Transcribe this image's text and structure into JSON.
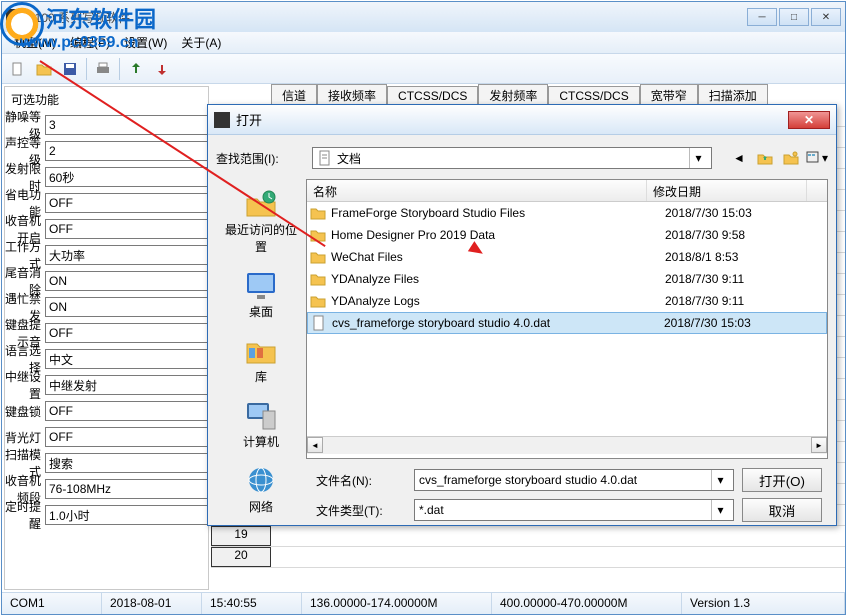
{
  "window": {
    "title": "9100 系列写频软件"
  },
  "menu": {
    "m1": "机型(M)",
    "m2": "编程(P)",
    "m3": "设置(W)",
    "m4": "关于(A)"
  },
  "sidebar": {
    "title": "可选功能",
    "rows": [
      {
        "label": "静噪等级",
        "value": "3"
      },
      {
        "label": "声控等级",
        "value": "2"
      },
      {
        "label": "发射限时",
        "value": "60秒"
      },
      {
        "label": "省电功能",
        "value": "OFF"
      },
      {
        "label": "收音机开启",
        "value": "OFF"
      },
      {
        "label": "工作方式",
        "value": "大功率"
      },
      {
        "label": "尾音消除",
        "value": "ON"
      },
      {
        "label": "遇忙禁发",
        "value": "ON"
      },
      {
        "label": "键盘提示音",
        "value": "OFF"
      },
      {
        "label": "语言选择",
        "value": "中文"
      },
      {
        "label": "中继设置",
        "value": "中继发射"
      },
      {
        "label": "键盘锁",
        "value": "OFF"
      },
      {
        "label": "背光灯",
        "value": "OFF"
      },
      {
        "label": "扫描模式",
        "value": "搜索"
      },
      {
        "label": "收音机频段",
        "value": "76-108MHz"
      },
      {
        "label": "定时提醒",
        "value": "1.0小时"
      }
    ]
  },
  "tabs": {
    "t1": "信道",
    "t2": "接收频率",
    "t3": "CTCSS/DCS",
    "t4": "发射频率",
    "t5": "CTCSS/DCS",
    "t6": "宽带窄",
    "t7": "扫描添加"
  },
  "grid_rows": [
    "19",
    "20"
  ],
  "status": {
    "port": "COM1",
    "date": "2018-08-01",
    "time": "15:40:55",
    "freq1": "136.00000-174.00000M",
    "freq2": "400.00000-470.00000M",
    "version": "Version 1.3"
  },
  "dialog": {
    "title": "打开",
    "lookin_label": "查找范围(I):",
    "lookin_value": "文档",
    "places": {
      "recent": "最近访问的位置",
      "desktop": "桌面",
      "library": "库",
      "computer": "计算机",
      "network": "网络"
    },
    "header_name": "名称",
    "header_date": "修改日期",
    "files": [
      {
        "name": "FrameForge Storyboard Studio Files",
        "date": "2018/7/30 15:03",
        "type": "folder"
      },
      {
        "name": "Home Designer Pro 2019 Data",
        "date": "2018/7/30 9:58",
        "type": "folder"
      },
      {
        "name": "WeChat Files",
        "date": "2018/8/1 8:53",
        "type": "folder"
      },
      {
        "name": "YDAnalyze Files",
        "date": "2018/7/30 9:11",
        "type": "folder"
      },
      {
        "name": "YDAnalyze Logs",
        "date": "2018/7/30 9:11",
        "type": "folder"
      },
      {
        "name": "cvs_frameforge storyboard studio 4.0.dat",
        "date": "2018/7/30 15:03",
        "type": "file"
      }
    ],
    "filename_label": "文件名(N):",
    "filename_value": "cvs_frameforge storyboard studio 4.0.dat",
    "filetype_label": "文件类型(T):",
    "filetype_value": "*.dat",
    "open_btn": "打开(O)",
    "cancel_btn": "取消"
  },
  "watermark": {
    "text": "河东软件园",
    "url": "www.pc0359.cn"
  }
}
